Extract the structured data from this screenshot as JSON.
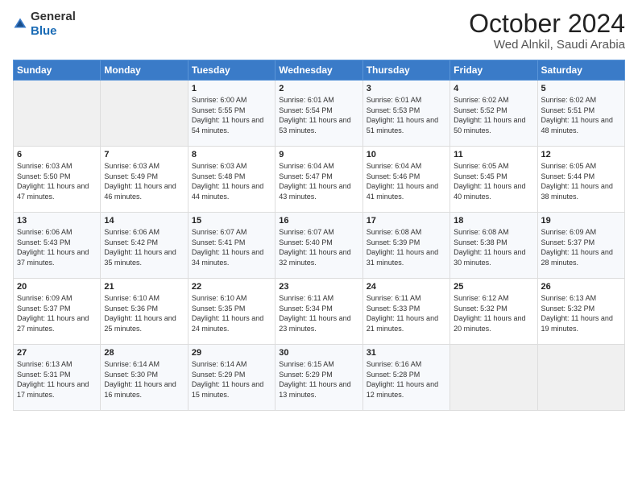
{
  "logo": {
    "general": "General",
    "blue": "Blue"
  },
  "header": {
    "month": "October 2024",
    "location": "Wed Alnkil, Saudi Arabia"
  },
  "days_of_week": [
    "Sunday",
    "Monday",
    "Tuesday",
    "Wednesday",
    "Thursday",
    "Friday",
    "Saturday"
  ],
  "weeks": [
    [
      {
        "day": "",
        "sunrise": "",
        "sunset": "",
        "daylight": ""
      },
      {
        "day": "",
        "sunrise": "",
        "sunset": "",
        "daylight": ""
      },
      {
        "day": "1",
        "sunrise": "Sunrise: 6:00 AM",
        "sunset": "Sunset: 5:55 PM",
        "daylight": "Daylight: 11 hours and 54 minutes."
      },
      {
        "day": "2",
        "sunrise": "Sunrise: 6:01 AM",
        "sunset": "Sunset: 5:54 PM",
        "daylight": "Daylight: 11 hours and 53 minutes."
      },
      {
        "day": "3",
        "sunrise": "Sunrise: 6:01 AM",
        "sunset": "Sunset: 5:53 PM",
        "daylight": "Daylight: 11 hours and 51 minutes."
      },
      {
        "day": "4",
        "sunrise": "Sunrise: 6:02 AM",
        "sunset": "Sunset: 5:52 PM",
        "daylight": "Daylight: 11 hours and 50 minutes."
      },
      {
        "day": "5",
        "sunrise": "Sunrise: 6:02 AM",
        "sunset": "Sunset: 5:51 PM",
        "daylight": "Daylight: 11 hours and 48 minutes."
      }
    ],
    [
      {
        "day": "6",
        "sunrise": "Sunrise: 6:03 AM",
        "sunset": "Sunset: 5:50 PM",
        "daylight": "Daylight: 11 hours and 47 minutes."
      },
      {
        "day": "7",
        "sunrise": "Sunrise: 6:03 AM",
        "sunset": "Sunset: 5:49 PM",
        "daylight": "Daylight: 11 hours and 46 minutes."
      },
      {
        "day": "8",
        "sunrise": "Sunrise: 6:03 AM",
        "sunset": "Sunset: 5:48 PM",
        "daylight": "Daylight: 11 hours and 44 minutes."
      },
      {
        "day": "9",
        "sunrise": "Sunrise: 6:04 AM",
        "sunset": "Sunset: 5:47 PM",
        "daylight": "Daylight: 11 hours and 43 minutes."
      },
      {
        "day": "10",
        "sunrise": "Sunrise: 6:04 AM",
        "sunset": "Sunset: 5:46 PM",
        "daylight": "Daylight: 11 hours and 41 minutes."
      },
      {
        "day": "11",
        "sunrise": "Sunrise: 6:05 AM",
        "sunset": "Sunset: 5:45 PM",
        "daylight": "Daylight: 11 hours and 40 minutes."
      },
      {
        "day": "12",
        "sunrise": "Sunrise: 6:05 AM",
        "sunset": "Sunset: 5:44 PM",
        "daylight": "Daylight: 11 hours and 38 minutes."
      }
    ],
    [
      {
        "day": "13",
        "sunrise": "Sunrise: 6:06 AM",
        "sunset": "Sunset: 5:43 PM",
        "daylight": "Daylight: 11 hours and 37 minutes."
      },
      {
        "day": "14",
        "sunrise": "Sunrise: 6:06 AM",
        "sunset": "Sunset: 5:42 PM",
        "daylight": "Daylight: 11 hours and 35 minutes."
      },
      {
        "day": "15",
        "sunrise": "Sunrise: 6:07 AM",
        "sunset": "Sunset: 5:41 PM",
        "daylight": "Daylight: 11 hours and 34 minutes."
      },
      {
        "day": "16",
        "sunrise": "Sunrise: 6:07 AM",
        "sunset": "Sunset: 5:40 PM",
        "daylight": "Daylight: 11 hours and 32 minutes."
      },
      {
        "day": "17",
        "sunrise": "Sunrise: 6:08 AM",
        "sunset": "Sunset: 5:39 PM",
        "daylight": "Daylight: 11 hours and 31 minutes."
      },
      {
        "day": "18",
        "sunrise": "Sunrise: 6:08 AM",
        "sunset": "Sunset: 5:38 PM",
        "daylight": "Daylight: 11 hours and 30 minutes."
      },
      {
        "day": "19",
        "sunrise": "Sunrise: 6:09 AM",
        "sunset": "Sunset: 5:37 PM",
        "daylight": "Daylight: 11 hours and 28 minutes."
      }
    ],
    [
      {
        "day": "20",
        "sunrise": "Sunrise: 6:09 AM",
        "sunset": "Sunset: 5:37 PM",
        "daylight": "Daylight: 11 hours and 27 minutes."
      },
      {
        "day": "21",
        "sunrise": "Sunrise: 6:10 AM",
        "sunset": "Sunset: 5:36 PM",
        "daylight": "Daylight: 11 hours and 25 minutes."
      },
      {
        "day": "22",
        "sunrise": "Sunrise: 6:10 AM",
        "sunset": "Sunset: 5:35 PM",
        "daylight": "Daylight: 11 hours and 24 minutes."
      },
      {
        "day": "23",
        "sunrise": "Sunrise: 6:11 AM",
        "sunset": "Sunset: 5:34 PM",
        "daylight": "Daylight: 11 hours and 23 minutes."
      },
      {
        "day": "24",
        "sunrise": "Sunrise: 6:11 AM",
        "sunset": "Sunset: 5:33 PM",
        "daylight": "Daylight: 11 hours and 21 minutes."
      },
      {
        "day": "25",
        "sunrise": "Sunrise: 6:12 AM",
        "sunset": "Sunset: 5:32 PM",
        "daylight": "Daylight: 11 hours and 20 minutes."
      },
      {
        "day": "26",
        "sunrise": "Sunrise: 6:13 AM",
        "sunset": "Sunset: 5:32 PM",
        "daylight": "Daylight: 11 hours and 19 minutes."
      }
    ],
    [
      {
        "day": "27",
        "sunrise": "Sunrise: 6:13 AM",
        "sunset": "Sunset: 5:31 PM",
        "daylight": "Daylight: 11 hours and 17 minutes."
      },
      {
        "day": "28",
        "sunrise": "Sunrise: 6:14 AM",
        "sunset": "Sunset: 5:30 PM",
        "daylight": "Daylight: 11 hours and 16 minutes."
      },
      {
        "day": "29",
        "sunrise": "Sunrise: 6:14 AM",
        "sunset": "Sunset: 5:29 PM",
        "daylight": "Daylight: 11 hours and 15 minutes."
      },
      {
        "day": "30",
        "sunrise": "Sunrise: 6:15 AM",
        "sunset": "Sunset: 5:29 PM",
        "daylight": "Daylight: 11 hours and 13 minutes."
      },
      {
        "day": "31",
        "sunrise": "Sunrise: 6:16 AM",
        "sunset": "Sunset: 5:28 PM",
        "daylight": "Daylight: 11 hours and 12 minutes."
      },
      {
        "day": "",
        "sunrise": "",
        "sunset": "",
        "daylight": ""
      },
      {
        "day": "",
        "sunrise": "",
        "sunset": "",
        "daylight": ""
      }
    ]
  ]
}
